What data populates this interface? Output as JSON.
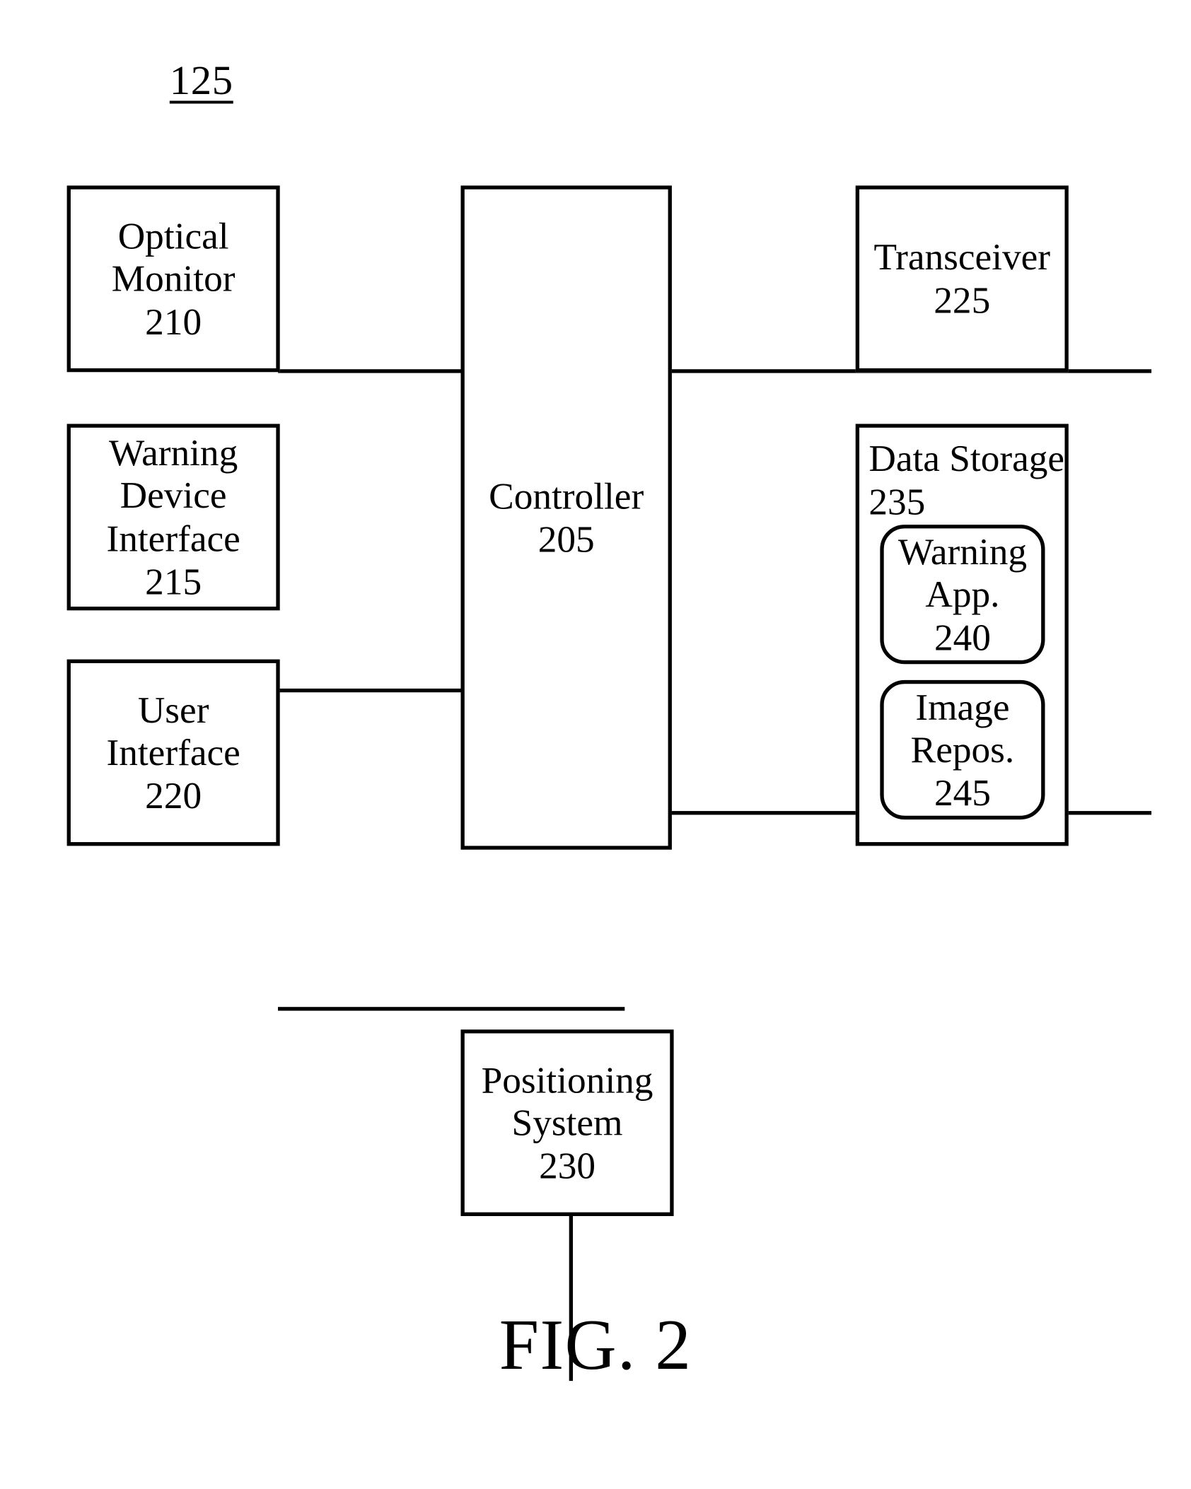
{
  "figure": {
    "system_reference": "125",
    "caption": "FIG. 2"
  },
  "blocks": {
    "optical_monitor": {
      "line1": "Optical",
      "line2": "Monitor",
      "ref": "210"
    },
    "warning_device_interface": {
      "line1": "Warning",
      "line2": "Device",
      "line3": "Interface",
      "ref": "215"
    },
    "user_interface": {
      "line1": "User",
      "line2": "Interface",
      "ref": "220"
    },
    "controller": {
      "line1": "Controller",
      "ref": "205"
    },
    "transceiver": {
      "line1": "Transceiver",
      "ref": "225"
    },
    "positioning_system": {
      "line1": "Positioning",
      "line2": "System",
      "ref": "230"
    },
    "data_storage": {
      "line1": "Data Storage",
      "ref": "235"
    },
    "warning_app": {
      "line1": "Warning",
      "line2": "App.",
      "ref": "240"
    },
    "image_repository": {
      "line1": "Image",
      "line2": "Repos.",
      "ref": "245"
    }
  },
  "connections": [
    {
      "from": "optical_monitor",
      "to": "controller"
    },
    {
      "from": "warning_device_interface",
      "to": "controller"
    },
    {
      "from": "user_interface",
      "to": "controller"
    },
    {
      "from": "controller",
      "to": "transceiver"
    },
    {
      "from": "controller",
      "to": "data_storage"
    },
    {
      "from": "controller",
      "to": "positioning_system"
    }
  ],
  "style": {
    "line_color": "#000000",
    "background": "#ffffff"
  }
}
